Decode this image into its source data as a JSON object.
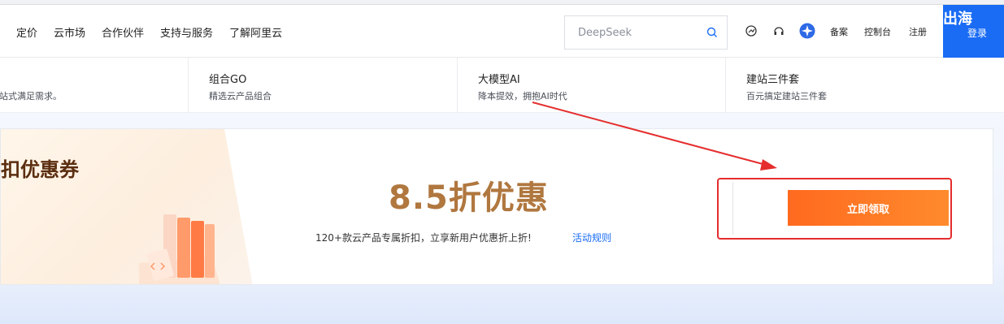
{
  "nav": {
    "items": [
      "定价",
      "云市场",
      "合作伙伴",
      "支持与服务",
      "了解阿里云"
    ],
    "search_placeholder": "DeepSeek",
    "links": [
      "备案",
      "控制台",
      "注册"
    ],
    "corner_text": "出海",
    "login_label": "登录"
  },
  "sub_nav": [
    {
      "title": "",
      "desc": "站式满足需求。"
    },
    {
      "title": "组合GO",
      "desc": "精选云产品组合"
    },
    {
      "title": "大模型AI",
      "desc": "降本提效，拥抱AI时代"
    },
    {
      "title": "建站三件套",
      "desc": "百元搞定建站三件套"
    }
  ],
  "promo": {
    "left_title": "扣优惠券",
    "title": "8.5折优惠",
    "subtitle": "120+款云产品专属折扣，立享新用户优惠折上折!",
    "rules_link": "活动规则",
    "cta": "立即领取"
  },
  "colors": {
    "accent_blue": "#1a6cf5",
    "cta_orange": "#ff6a1f",
    "title_gold": "#b0773f",
    "annotation_red": "#e52d2d"
  }
}
